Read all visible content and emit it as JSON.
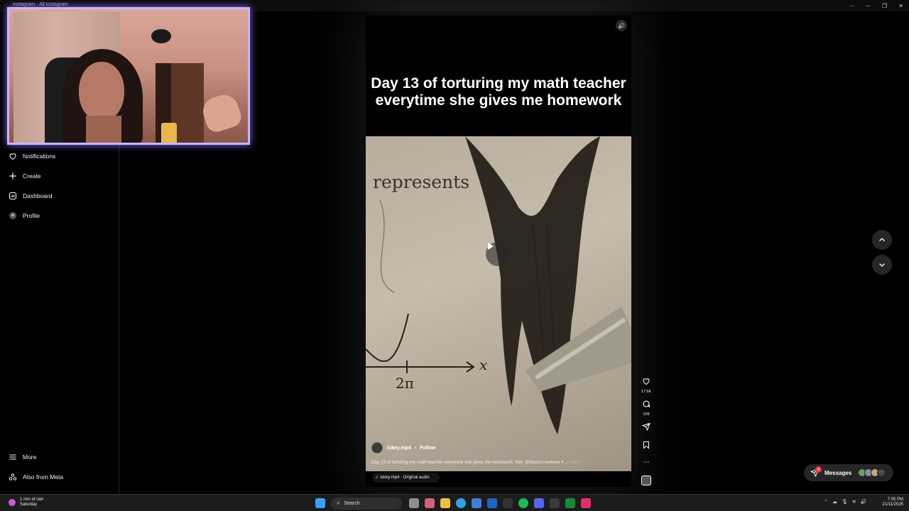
{
  "window": {
    "title": "Instagram - All Instagram",
    "controls": [
      "more-icon",
      "minimize-icon",
      "restore-icon",
      "close-icon"
    ]
  },
  "sidebar": {
    "items": [
      {
        "label": "Notifications",
        "icon": "heart-icon"
      },
      {
        "label": "Create",
        "icon": "plus-icon"
      },
      {
        "label": "Dashboard",
        "icon": "dashboard-icon"
      },
      {
        "label": "Profile",
        "icon": "profile-icon"
      }
    ],
    "footer": [
      {
        "label": "More",
        "icon": "menu-icon"
      },
      {
        "label": "Also from Meta",
        "icon": "meta-icon"
      }
    ]
  },
  "reel": {
    "caption_title": "Day 13 of torturing my math teacher everytime she gives me homework",
    "video_text": {
      "word": "represents",
      "axis_label": "x",
      "tick_label": "2π"
    },
    "author": "lukey.mp4",
    "separator": "•",
    "follow": "Follow",
    "description": "Day 13 of torturing my math teacher everytime she gives me homework. Ref: @doctor.nowhere # ...",
    "more": "more",
    "audio": "lukey.mp4 · Original audio"
  },
  "actions": {
    "likes": "17.6K",
    "comments": "109"
  },
  "messages": {
    "label": "Messages",
    "badge": "6"
  },
  "taskbar": {
    "weather_line1": "1 mm of rain",
    "weather_line2": "Saturday",
    "search_placeholder": "Search",
    "time": "7:05 PM",
    "date": "21/11/2025"
  },
  "colors": {
    "webcam_border": "#c6b6ff",
    "badge": "#ff3040",
    "accent_bg": "#262626"
  }
}
